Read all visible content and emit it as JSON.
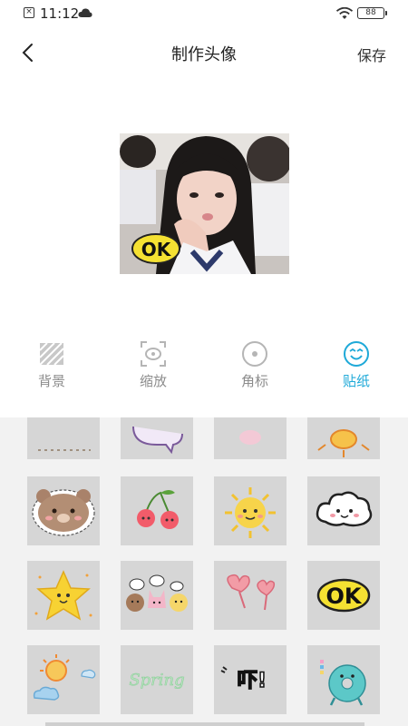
{
  "status": {
    "time": "11:12",
    "battery": "88"
  },
  "header": {
    "title": "制作头像",
    "save_label": "保存"
  },
  "preview": {
    "sticker_text": "OK"
  },
  "tools": [
    {
      "label": "背景",
      "icon": "hatch-icon",
      "active": false
    },
    {
      "label": "缩放",
      "icon": "zoom-frame-icon",
      "active": false
    },
    {
      "label": "角标",
      "icon": "badge-circle-icon",
      "active": false
    },
    {
      "label": "贴纸",
      "icon": "smiley-icon",
      "active": true
    }
  ],
  "stickers": [
    {
      "name": "partial-sticker-1"
    },
    {
      "name": "speech-bubble-sticker"
    },
    {
      "name": "partial-sticker-3"
    },
    {
      "name": "sun-sticker-partial"
    },
    {
      "name": "bear-sticker"
    },
    {
      "name": "cherry-sticker"
    },
    {
      "name": "sun-sticker"
    },
    {
      "name": "cloud-sticker"
    },
    {
      "name": "star-sticker"
    },
    {
      "name": "animal-friends-sticker"
    },
    {
      "name": "hearts-sticker"
    },
    {
      "name": "ok-sticker",
      "text": "OK"
    },
    {
      "name": "sunny-cloud-sticker"
    },
    {
      "name": "spring-sticker",
      "text": "Spring"
    },
    {
      "name": "ya-sticker",
      "text": "吓!"
    },
    {
      "name": "donut-sticker"
    }
  ],
  "colors": {
    "accent": "#1ea9d8",
    "inactive": "#8c8c8c",
    "panel_bg": "#f2f2f2",
    "tile_bg": "#d6d6d6"
  }
}
